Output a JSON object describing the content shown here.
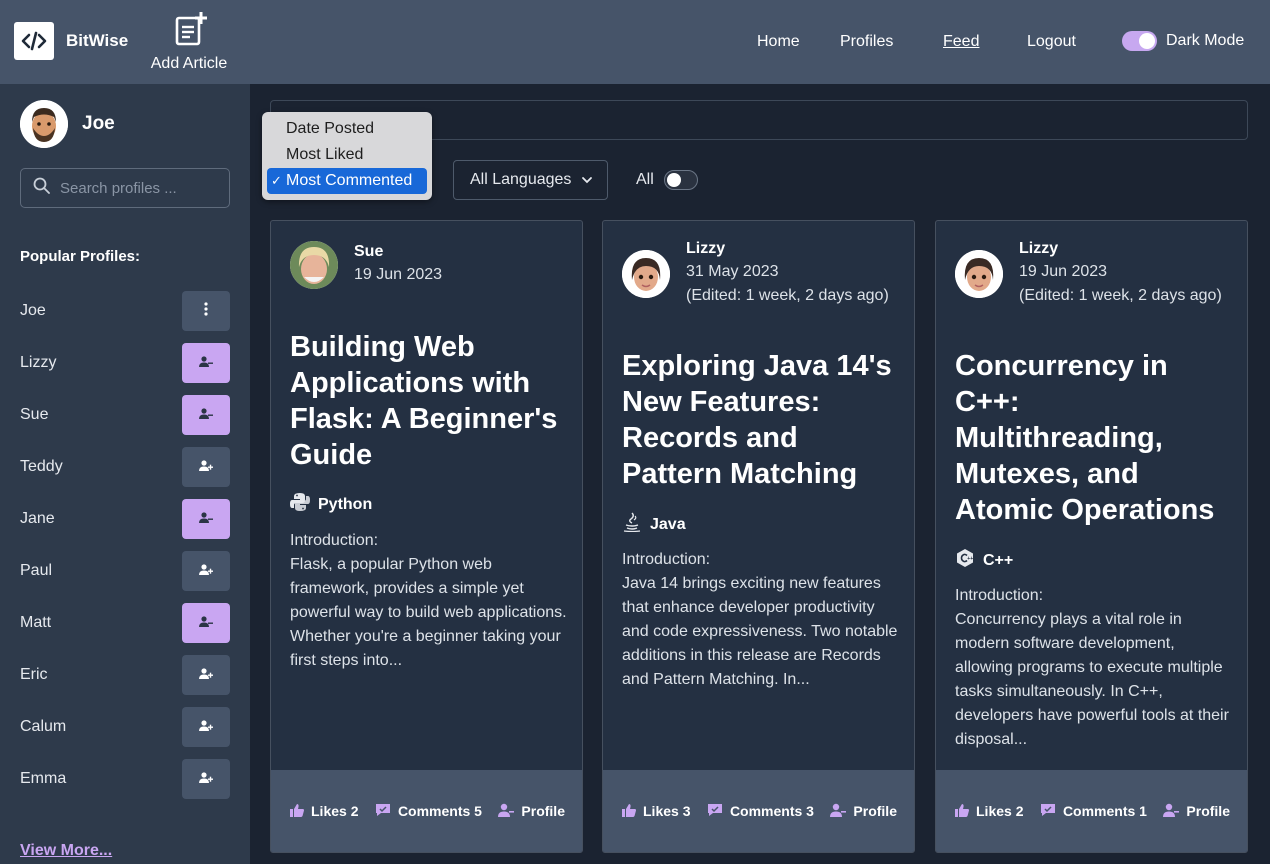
{
  "navbar": {
    "brand": "BitWise",
    "add_article": "Add Article",
    "links": [
      "Home",
      "Profiles",
      "Feed",
      "Logout"
    ],
    "active_link": "Feed",
    "dark_mode_label": "Dark Mode",
    "dark_mode_on": true
  },
  "sidebar": {
    "user_name": "Joe",
    "search_placeholder": "Search profiles ...",
    "popular_title": "Popular Profiles:",
    "profiles": [
      {
        "name": "Joe",
        "action": "menu"
      },
      {
        "name": "Lizzy",
        "action": "unfollow"
      },
      {
        "name": "Sue",
        "action": "unfollow"
      },
      {
        "name": "Teddy",
        "action": "follow"
      },
      {
        "name": "Jane",
        "action": "unfollow"
      },
      {
        "name": "Paul",
        "action": "follow"
      },
      {
        "name": "Matt",
        "action": "unfollow"
      },
      {
        "name": "Eric",
        "action": "follow"
      },
      {
        "name": "Calum",
        "action": "follow"
      },
      {
        "name": "Emma",
        "action": "follow"
      }
    ],
    "view_more": "View More..."
  },
  "filters": {
    "sort_options": [
      "Date Posted",
      "Most Liked",
      "Most Commented"
    ],
    "sort_selected": "Most Commented",
    "language": "All Languages",
    "all_label": "All",
    "all_on": false
  },
  "articles": [
    {
      "author": "Sue",
      "date": "19 Jun 2023",
      "edited": "",
      "title": "Building Web Applications with Flask: A Beginner's Guide",
      "language": "Python",
      "intro_heading": "Introduction:",
      "intro": "Flask, a popular Python web framework, provides a simple yet powerful way to build web applications. Whether you're a beginner taking your first steps into...",
      "likes": "Likes 2",
      "comments": "Comments 5",
      "profile": "Profile"
    },
    {
      "author": "Lizzy",
      "date": "31 May 2023",
      "edited": "(Edited: 1 week, 2 days ago)",
      "title": "Exploring Java 14's New Features: Records and Pattern Matching",
      "language": "Java",
      "intro_heading": "Introduction:",
      "intro": "Java 14 brings exciting new features that enhance developer productivity and code expressiveness. Two notable additions in this release are Records and Pattern Matching. In...",
      "likes": "Likes 3",
      "comments": "Comments 3",
      "profile": "Profile"
    },
    {
      "author": "Lizzy",
      "date": "19 Jun 2023",
      "edited": "(Edited: 1 week, 2 days ago)",
      "title": "Concurrency in C++: Multithreading, Mutexes, and Atomic Operations",
      "language": "C++",
      "intro_heading": "Introduction:",
      "intro": "Concurrency plays a vital role in modern software development, allowing programs to execute multiple tasks simultaneously. In C++, developers have powerful tools at their disposal...",
      "likes": "Likes 2",
      "comments": "Comments 1",
      "profile": "Profile"
    }
  ],
  "colors": {
    "navbar": "#465469",
    "sidebar": "#2e3a4b",
    "background": "#1b2331",
    "accent": "#c9a6f2",
    "selected_option": "#1868d8"
  }
}
